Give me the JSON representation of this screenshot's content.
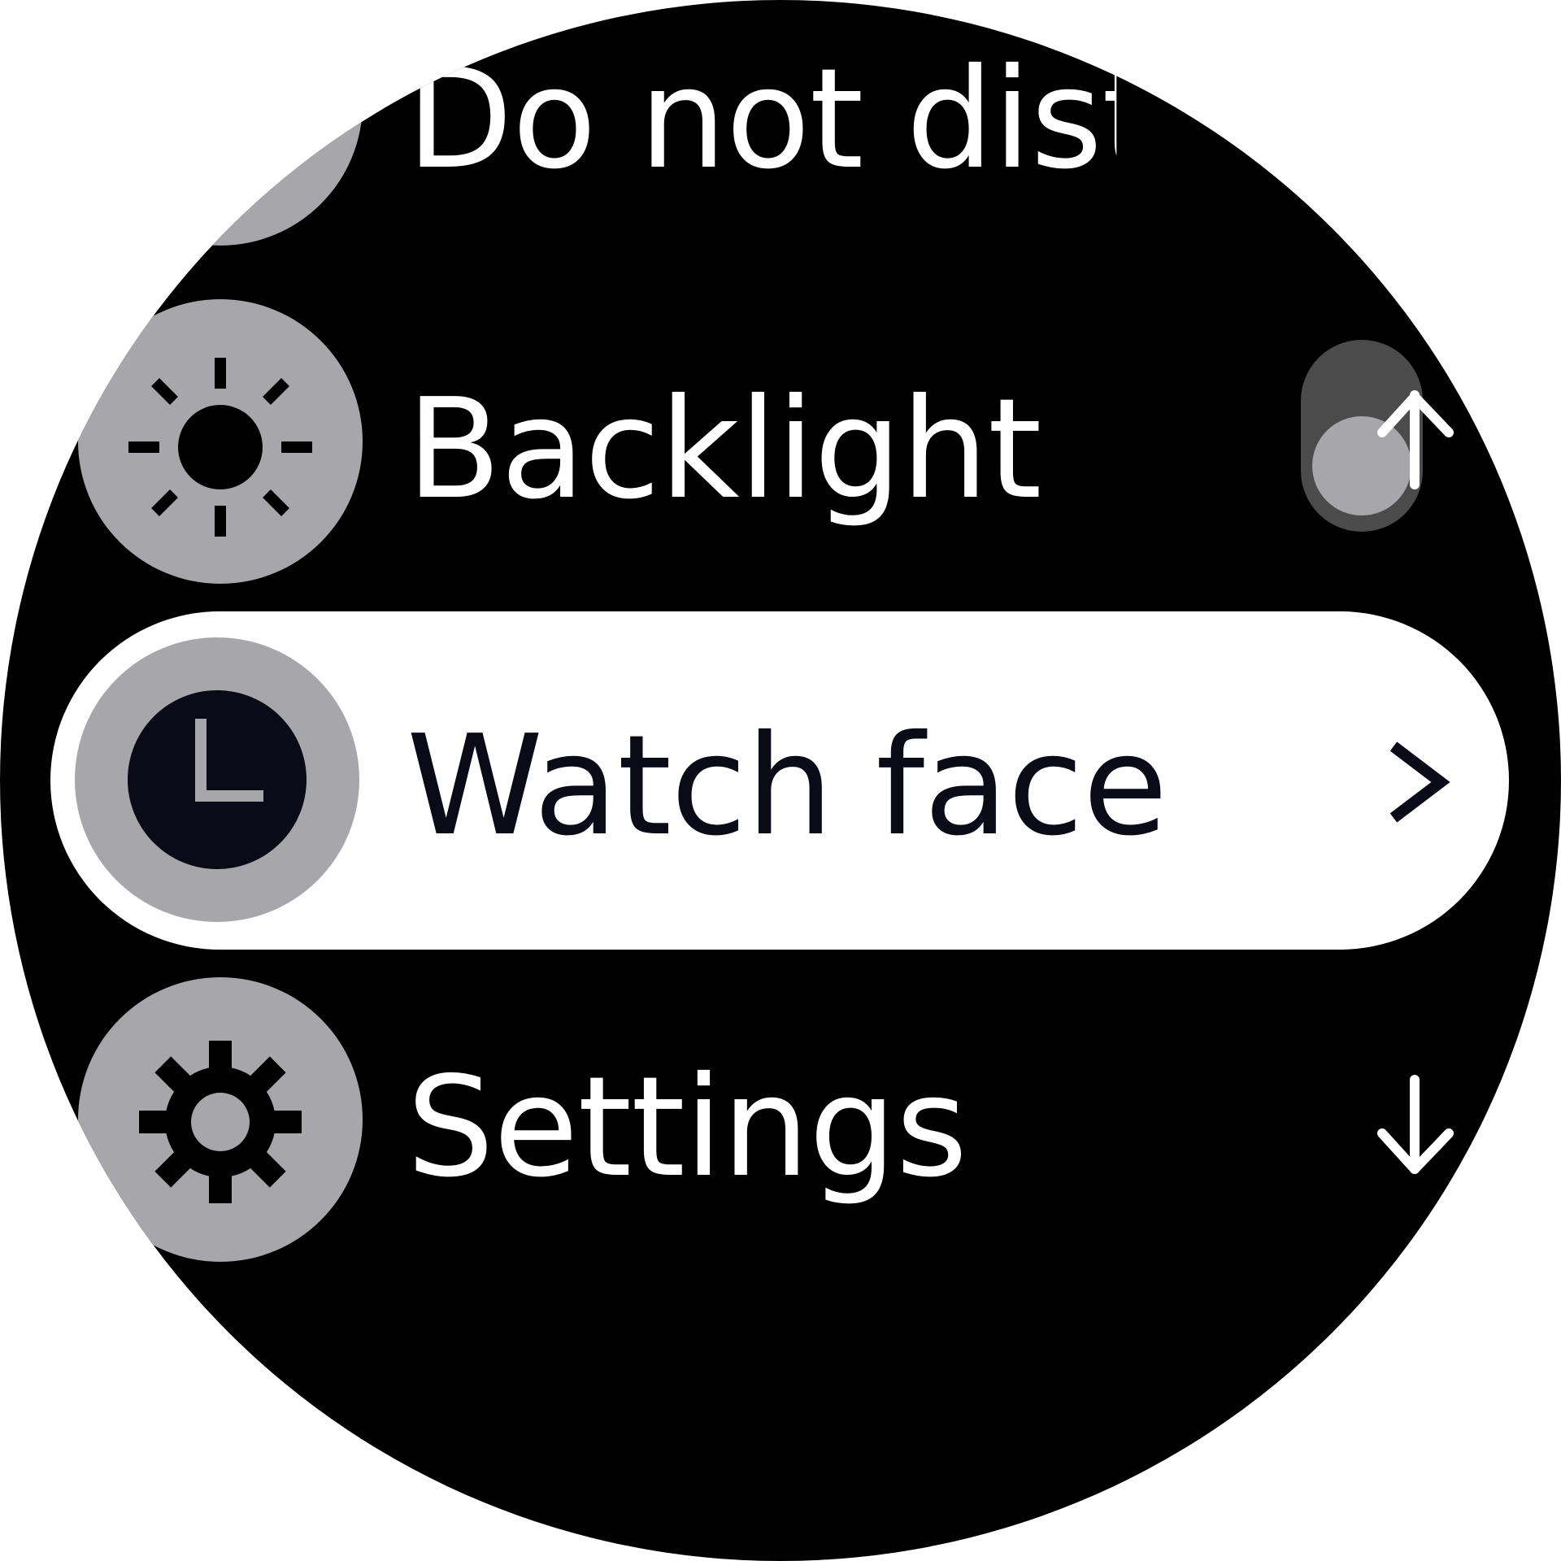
{
  "menu": {
    "items": [
      {
        "id": "do-not-disturb",
        "label": "Do not disturb",
        "icon": "do-not-disturb-icon"
      },
      {
        "id": "backlight",
        "label": "Backlight",
        "icon": "sun-icon"
      },
      {
        "id": "watch-face",
        "label": "Watch face",
        "icon": "clock-icon",
        "selected": true
      },
      {
        "id": "settings",
        "label": "Settings",
        "icon": "gear-icon"
      }
    ]
  },
  "indicators": {
    "scroll_up": "up-arrow-icon",
    "scroll_down": "down-arrow-icon",
    "chevron": "chevron-right-icon"
  },
  "colors": {
    "background": "#000000",
    "icon_circle": "#a7a7ab",
    "highlight": "#ffffff",
    "text": "#ffffff",
    "selected_text": "#0b0b17"
  }
}
